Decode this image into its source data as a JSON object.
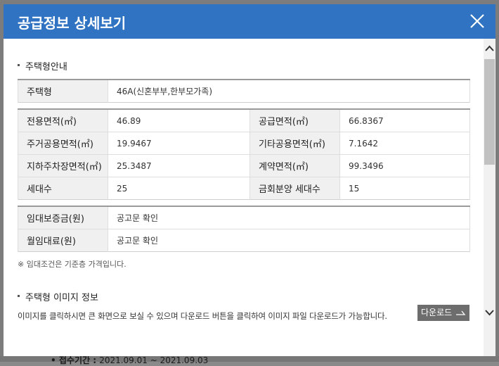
{
  "modal": {
    "title": "공급정보 상세보기",
    "close_label": "×"
  },
  "section_housing": {
    "title": "주택형안내"
  },
  "housing_type": {
    "label": "주택형",
    "value": "46A(신혼부부,한부모가족)"
  },
  "areas": [
    {
      "label_left": "전용면적(㎡)",
      "value_left": "46.89",
      "label_right": "공급면적(㎡)",
      "value_right": "66.8367"
    },
    {
      "label_left": "주거공용면적(㎡)",
      "value_left": "19.9467",
      "label_right": "기타공용면적(㎡)",
      "value_right": "7.1642"
    },
    {
      "label_left": "지하주차장면적(㎡)",
      "value_left": "25.3487",
      "label_right": "계약면적(㎡)",
      "value_right": "99.3496"
    },
    {
      "label_left": "세대수",
      "value_left": "25",
      "label_right": "금회분양 세대수",
      "value_right": "15"
    }
  ],
  "rent": [
    {
      "label": "임대보증금(원)",
      "value": "공고문 확인"
    },
    {
      "label": "월임대료(원)",
      "value": "공고문 확인"
    }
  ],
  "note": "※ 임대조건은 기준층 가격입니다.",
  "section_image": {
    "title": "주택형 이미지 정보",
    "description": "이미지를 클릭하시면 큰 화면으로 보실 수 있으며 다운로드 버튼을 클릭하여 이미지 파일 다운로드가 가능합니다.",
    "download_label": "다운로드"
  },
  "backdrop": {
    "label": "접수기간 :",
    "value": "2021.09.01 ~ 2021.09.03"
  },
  "colors": {
    "header": "#2f73c2",
    "download_button": "#6d6d6d"
  }
}
